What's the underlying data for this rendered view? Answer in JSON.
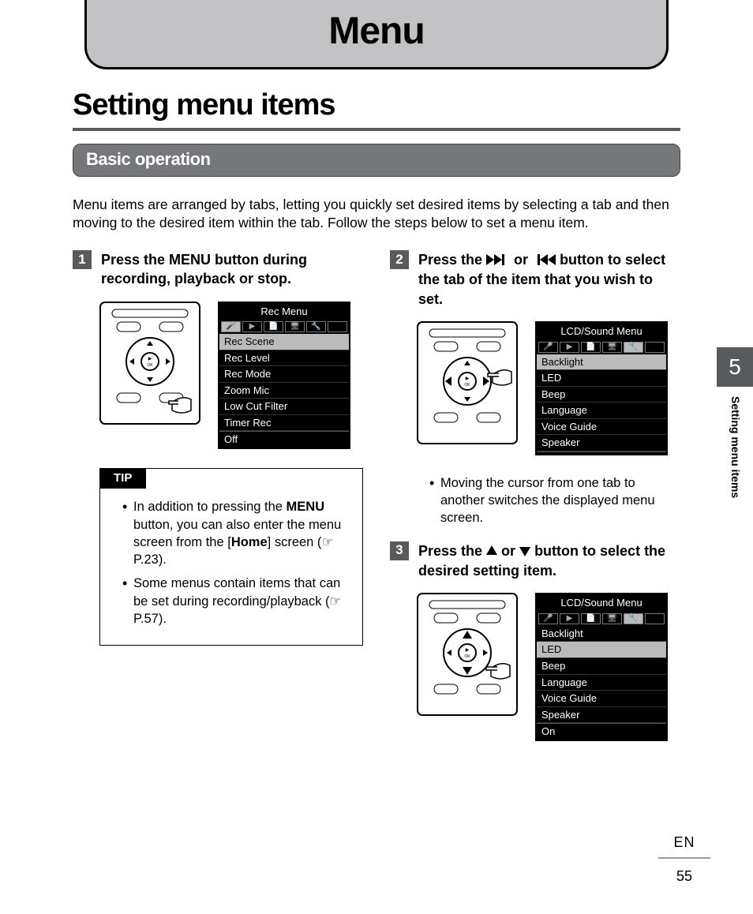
{
  "chapter_title": "Menu",
  "page_title": "Setting menu items",
  "subhead": "Basic operation",
  "intro": "Menu items are arranged by tabs, letting you quickly set desired items by selecting a tab and then moving to the desired item within the tab. Follow the steps below to set a menu item.",
  "steps": {
    "s1": {
      "num": "1",
      "pre": "Press the ",
      "button": "MENU",
      "post": " button during recording, playback or stop."
    },
    "s2": {
      "num": "2",
      "pre": "Press the ",
      "mid": " or ",
      "post": " button to select the tab of the item that you wish to set."
    },
    "s3": {
      "num": "3",
      "pre": "Press the ",
      "mid": " or ",
      "post": " button to select the desired setting item."
    }
  },
  "tip": {
    "label": "TIP",
    "items": {
      "i1a": "In addition to pressing the ",
      "i1b": "MENU",
      "i1c": " button, you can also enter the menu screen from the [",
      "i1d": "Home",
      "i1e": "] screen (",
      "i1f": " P.23).",
      "i2a": "Some menus contain items that can be set during recording/playback (",
      "i2b": " P.57)."
    }
  },
  "note2": "Moving the cursor from one tab to another switches the displayed menu screen.",
  "lcd1": {
    "title": "Rec Menu",
    "items": [
      "Rec Scene",
      "Rec Level",
      "Rec Mode",
      "Zoom Mic",
      "Low Cut Filter",
      "Timer Rec"
    ],
    "selected": 0,
    "tab_selected": 0,
    "foot": "Off"
  },
  "lcd2": {
    "title": "LCD/Sound Menu",
    "items": [
      "Backlight",
      "LED",
      "Beep",
      "Language",
      "Voice Guide",
      "Speaker"
    ],
    "selected": 0,
    "tab_selected": 4,
    "foot": ""
  },
  "lcd3": {
    "title": "LCD/Sound Menu",
    "items": [
      "Backlight",
      "LED",
      "Beep",
      "Language",
      "Voice Guide",
      "Speaker"
    ],
    "selected": 1,
    "tab_selected": 4,
    "foot": "On"
  },
  "side": {
    "num": "5",
    "label": "Setting menu items"
  },
  "footer": {
    "lang": "EN",
    "page": "55"
  }
}
